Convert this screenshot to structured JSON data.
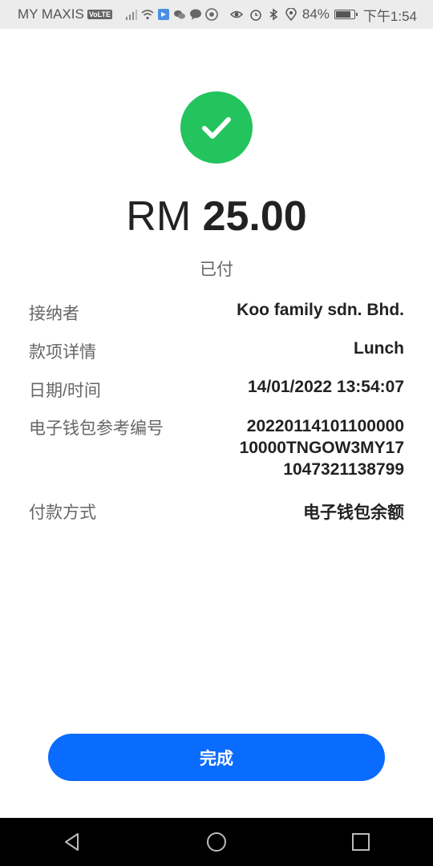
{
  "status_bar": {
    "carrier": "MY MAXIS",
    "volte": "VoLTE",
    "battery": "84%",
    "battery_level": 0.84,
    "time": "下午1:54",
    "icons": [
      "signal-icon",
      "wifi-icon",
      "app-icon",
      "wechat-icon",
      "message-icon",
      "chrome-icon",
      "eye-icon",
      "alarm-icon",
      "bluetooth-icon",
      "location-icon",
      "battery-icon"
    ]
  },
  "payment": {
    "currency": "RM",
    "amount": "25.00",
    "status": "已付",
    "success_color": "#23c35d"
  },
  "details": [
    {
      "label": "接纳者",
      "value": "Koo family sdn. Bhd."
    },
    {
      "label": "款项详情",
      "value": "Lunch"
    },
    {
      "label": "日期/时间",
      "value": "14/01/2022 13:54:07"
    },
    {
      "label": "电子钱包参考编号",
      "value_lines": [
        "20220114101100000",
        "10000TNGOW3MY17",
        "1047321138799"
      ]
    },
    {
      "label": "付款方式",
      "value": "电子钱包余额"
    }
  ],
  "actions": {
    "done_label": "完成",
    "accent": "#0a6cff"
  },
  "nav_bar": {
    "buttons": [
      "back-icon",
      "home-icon",
      "recents-icon"
    ]
  }
}
